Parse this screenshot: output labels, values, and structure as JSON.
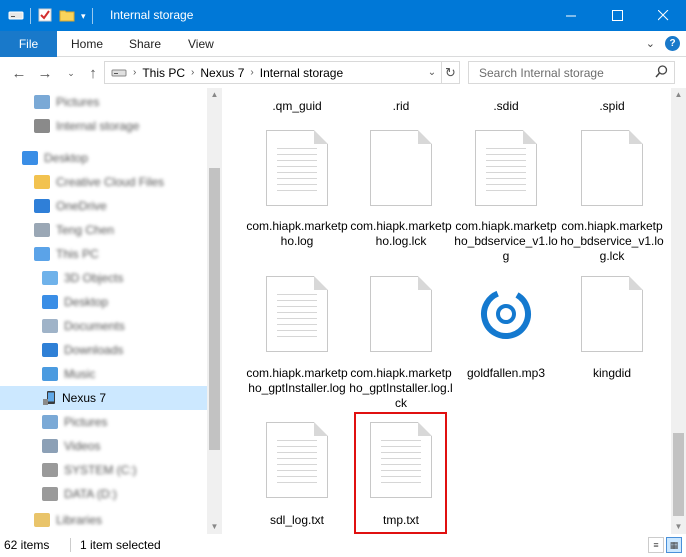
{
  "window": {
    "title": "Internal storage",
    "colors": {
      "titlebar": "#0078d7",
      "file_tab": "#1979ca",
      "selection": "#cce8ff",
      "highlight": "#e01010"
    }
  },
  "ribbon": {
    "file_tab": "File",
    "tabs": [
      "Home",
      "Share",
      "View"
    ]
  },
  "address": {
    "crumbs": [
      "This PC",
      "Nexus 7",
      "Internal storage"
    ],
    "search_placeholder": "Search Internal storage"
  },
  "nav_pane": {
    "items": [
      {
        "label": "Pictures",
        "icon": "pictures-icon"
      },
      {
        "label": "Internal storage",
        "icon": "drive-icon"
      },
      {
        "label": "Desktop",
        "icon": "desktop-icon"
      },
      {
        "label": "Creative Cloud Files",
        "icon": "folder-icon"
      },
      {
        "label": "OneDrive",
        "icon": "cloud-icon"
      },
      {
        "label": "Teng Chen",
        "icon": "user-icon"
      },
      {
        "label": "This PC",
        "icon": "computer-icon"
      },
      {
        "label": "3D Objects",
        "icon": "cube-icon"
      },
      {
        "label": "Desktop",
        "icon": "desktop-icon"
      },
      {
        "label": "Documents",
        "icon": "documents-icon"
      },
      {
        "label": "Downloads",
        "icon": "download-icon"
      },
      {
        "label": "Music",
        "icon": "music-icon"
      },
      {
        "label": "Nexus 7",
        "icon": "phone-icon",
        "selected": true
      },
      {
        "label": "Pictures",
        "icon": "pictures-icon"
      },
      {
        "label": "Videos",
        "icon": "videos-icon"
      },
      {
        "label": "SYSTEM (C:)",
        "icon": "drive-icon"
      },
      {
        "label": "DATA (D:)",
        "icon": "drive-icon"
      },
      {
        "label": "Libraries",
        "icon": "library-icon"
      }
    ]
  },
  "files": {
    "top_row": [
      ".qm_guid",
      ".rid",
      ".sdid",
      ".spid"
    ],
    "row2": [
      "com.hiapk.marketpho.log",
      "com.hiapk.marketpho.log.lck",
      "com.hiapk.marketpho_bdservice_v1.log",
      "com.hiapk.marketpho_bdservice_v1.log.lck"
    ],
    "row3": [
      "com.hiapk.marketpho_gptInstaller.log",
      "com.hiapk.marketpho_gptInstaller.log.lck",
      "goldfallen.mp3",
      "kingdid"
    ],
    "row4": [
      "sdl_log.txt",
      "tmp.txt"
    ]
  },
  "status": {
    "item_count": "62 items",
    "selection": "1 item selected"
  }
}
